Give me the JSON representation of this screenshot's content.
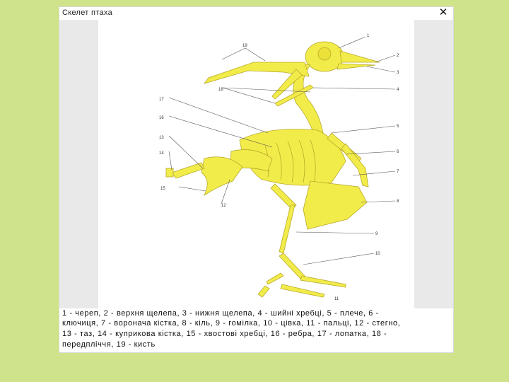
{
  "window": {
    "title": "Скелет птаха",
    "close_glyph": "✕"
  },
  "figure": {
    "labels": [
      "1",
      "2",
      "3",
      "4",
      "5",
      "6",
      "7",
      "8",
      "9",
      "10",
      "11",
      "12",
      "13",
      "14",
      "15",
      "16",
      "17",
      "18",
      "19"
    ]
  },
  "caption": {
    "lines": [
      "1 - череп, 2 - верхня щелепа, 3 - нижня щелепа, 4 - шийні хребці, 5 - плече, 6 -",
      "ключиця, 7 - воронача кістка, 8 - кіль, 9 - гомілка, 10 - цівка, 11 - пальці, 12 - стегно,",
      "13 - таз, 14 - куприкова кістка, 15 - хвостові хребці, 16 - ребра, 17 - лопатка, 18 -",
      "передпліччя, 19 - кисть"
    ]
  },
  "colors": {
    "background": "#cfe38a",
    "bone": "#f2ec4a",
    "bone_outline": "#b8a92a"
  }
}
